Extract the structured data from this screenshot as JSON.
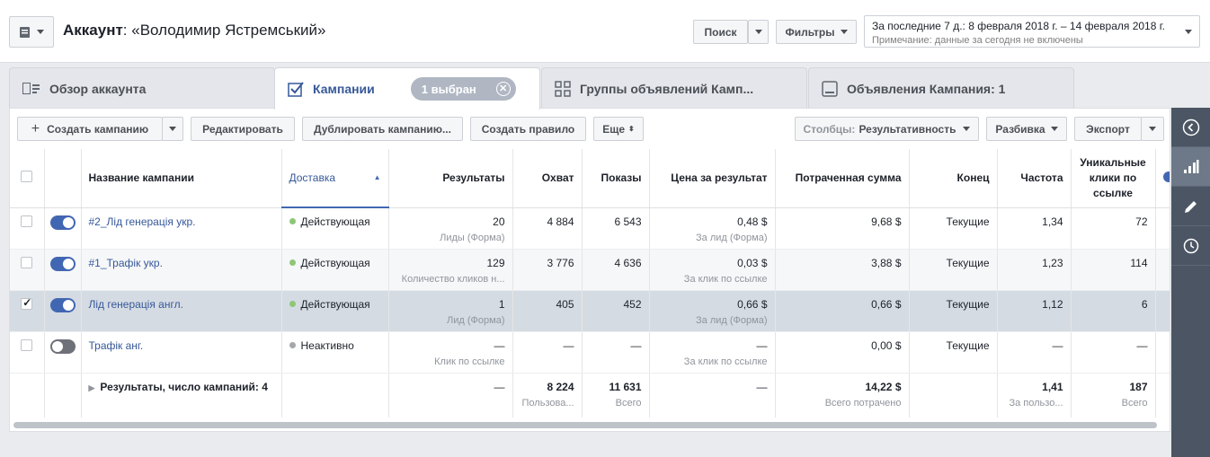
{
  "header": {
    "account_label": "Аккаунт",
    "account_name": ": «Володимир Ястремський»",
    "search_label": "Поиск",
    "filters_label": "Фильтры",
    "date_range": "За последние 7 д.: 8 февраля 2018 г. – 14 февраля 2018 г.",
    "date_note": "Примечание: данные за сегодня не включены"
  },
  "tabs": [
    {
      "label": "Обзор аккаунта"
    },
    {
      "label": "Кампании",
      "selected_badge": "1 выбран"
    },
    {
      "label": "Группы объявлений Камп..."
    },
    {
      "label": "Объявления Кампания: 1"
    }
  ],
  "toolbar": {
    "create": "Создать кампанию",
    "edit": "Редактировать",
    "duplicate": "Дублировать кампанию...",
    "create_rule": "Создать правило",
    "more": "Еще",
    "columns_prefix": "Столбцы:",
    "columns_value": "Результативность",
    "breakdown": "Разбивка",
    "export": "Экспорт"
  },
  "table": {
    "columns": {
      "name": "Название кампании",
      "delivery": "Доставка",
      "results": "Результаты",
      "reach": "Охват",
      "impressions": "Показы",
      "cost": "Цена за результат",
      "spent": "Потраченная сумма",
      "end": "Конец",
      "frequency": "Частота",
      "unique_clicks": "Уникальные клики по ссылке"
    },
    "rows": [
      {
        "name": "#2_Лід генерація укр.",
        "delivery": "Действующая",
        "results": "20",
        "results_sub": "Лиды (Форма)",
        "reach": "4 884",
        "impressions": "6 543",
        "cost": "0,48 $",
        "cost_sub": "За лид (Форма)",
        "spent": "9,68 $",
        "end": "Текущие",
        "frequency": "1,34",
        "unique_clicks": "72"
      },
      {
        "name": "#1_Трафік укр.",
        "delivery": "Действующая",
        "results": "129",
        "results_sub": "Количество кликов н...",
        "reach": "3 776",
        "impressions": "4 636",
        "cost": "0,03 $",
        "cost_sub": "За клик по ссылке",
        "spent": "3,88 $",
        "end": "Текущие",
        "frequency": "1,23",
        "unique_clicks": "114"
      },
      {
        "name": "Лід генерація англ.",
        "delivery": "Действующая",
        "results": "1",
        "results_sub": "Лид (Форма)",
        "reach": "405",
        "impressions": "452",
        "cost": "0,66 $",
        "cost_sub": "За лид (Форма)",
        "spent": "0,66 $",
        "end": "Текущие",
        "frequency": "1,12",
        "unique_clicks": "6"
      },
      {
        "name": "Трафік анг.",
        "delivery": "Неактивно",
        "results": "—",
        "results_sub": "Клик по ссылке",
        "reach": "—",
        "impressions": "—",
        "cost": "—",
        "cost_sub": "За клик по ссылке",
        "spent": "0,00 $",
        "end": "Текущие",
        "frequency": "—",
        "unique_clicks": "—"
      }
    ],
    "summary": {
      "label": "Результаты, число кампаний: 4",
      "results": "—",
      "reach": "8 224",
      "reach_sub": "Пользова...",
      "impressions": "11 631",
      "impressions_sub": "Всего",
      "cost": "—",
      "spent": "14,22 $",
      "spent_sub": "Всего потрачено",
      "frequency": "1,41",
      "frequency_sub": "За пользо...",
      "unique_clicks": "187",
      "unique_clicks_sub": "Всего"
    }
  }
}
